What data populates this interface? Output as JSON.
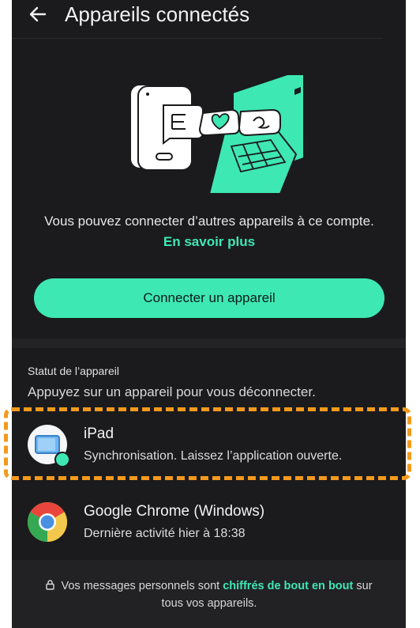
{
  "header": {
    "title": "Appareils connectés",
    "back_icon": "arrow-left-icon"
  },
  "hero": {
    "illustration": "phone-laptop-chat-illustration"
  },
  "intro": {
    "text": "Vous pouvez connecter d’autres appareils à ce compte.",
    "link": "En savoir plus"
  },
  "connect_button": {
    "label": "Connecter un appareil"
  },
  "devices_section": {
    "title": "Statut de l’appareil",
    "hint": "Appuyez sur un appareil pour vous déconnecter.",
    "devices": [
      {
        "name": "iPad",
        "status": "Synchronisation. Laissez l’application ouverte.",
        "icon": "tablet-icon",
        "badge": "sync-icon"
      },
      {
        "name": "Google Chrome (Windows)",
        "status": "Dernière activité hier à 18:38",
        "icon": "chrome-icon"
      }
    ]
  },
  "footer": {
    "text_before": "Vos messages personnels sont",
    "emphasis": "chiffrés de bout en bout",
    "text_after": "sur tous vos appareils.",
    "icon": "lock-icon"
  },
  "colors": {
    "background": "#1b1b1d",
    "accent": "#3ee8b2",
    "highlight_border": "#f39a1d"
  }
}
